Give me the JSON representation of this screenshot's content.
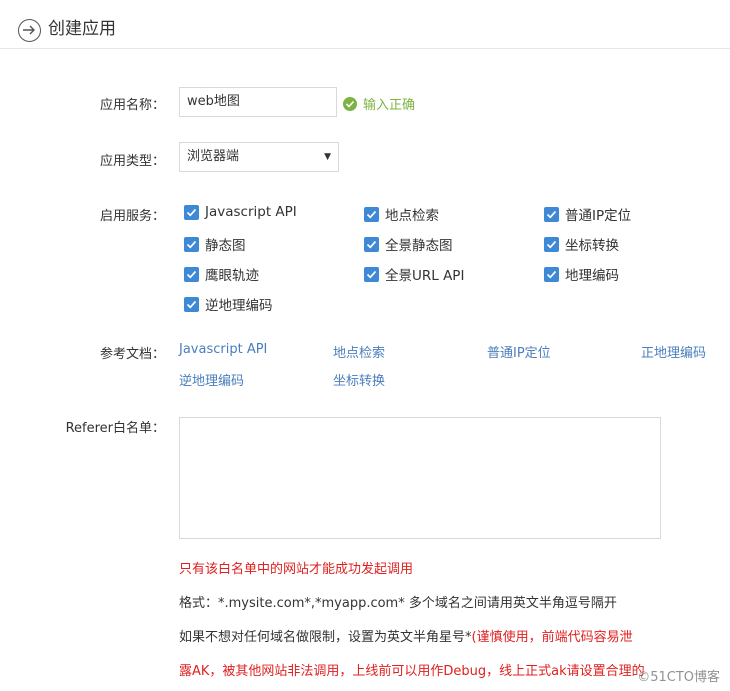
{
  "header": {
    "title": "创建应用"
  },
  "form": {
    "name_label": "应用名称：",
    "name_value": "web地图",
    "name_valid": "输入正确",
    "type_label": "应用类型：",
    "type_value": "浏览器端",
    "services_label": "启用服务：",
    "docs_label": "参考文档：",
    "referer_label": "Referer白名单："
  },
  "services": [
    {
      "label": "Javascript API",
      "checked": true
    },
    {
      "label": "地点检索",
      "checked": true
    },
    {
      "label": "普通IP定位",
      "checked": true
    },
    {
      "label": "静态图",
      "checked": true
    },
    {
      "label": "全景静态图",
      "checked": true
    },
    {
      "label": "坐标转换",
      "checked": true
    },
    {
      "label": "鹰眼轨迹",
      "checked": true
    },
    {
      "label": "全景URL API",
      "checked": true
    },
    {
      "label": "地理编码",
      "checked": true
    },
    {
      "label": "逆地理编码",
      "checked": true
    }
  ],
  "docs": [
    "Javascript API",
    "地点检索",
    "普通IP定位",
    "正地理编码",
    "逆地理编码",
    "坐标转换"
  ],
  "notes": {
    "only_whitelist": "只有该白名单中的网站才能成功发起调用",
    "format": "格式：*.mysite.com*,*myapp.com* 多个域名之间请用英文半角逗号隔开",
    "no_limit_prefix": "如果不想对任何域名做限制，设置为英文半角星号*",
    "no_limit_warning": "(谨慎使用，前端代码容易泄",
    "leak_line": "露AK，被其他网站非法调用，上线前可以用作Debug，线上正式ak请设置合理的"
  },
  "watermark": "©51CTO博客",
  "colors": {
    "link": "#4a7ebd",
    "checkbox": "#3d89d6",
    "valid": "#7cb342",
    "warning": "#e02020"
  }
}
